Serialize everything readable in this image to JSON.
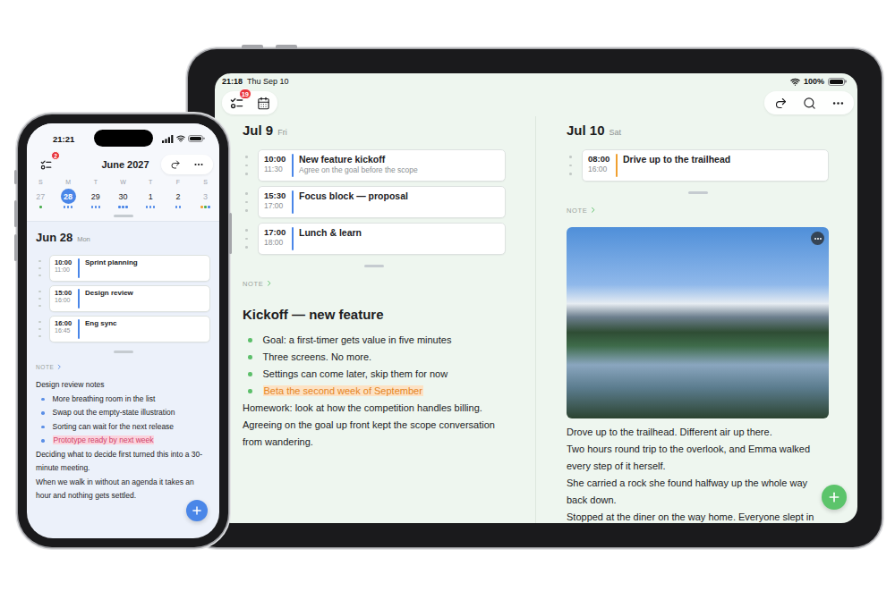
{
  "phone": {
    "status": {
      "time": "21:21",
      "battery_level": 1
    },
    "toolbar": {
      "badge": "2",
      "title": "June 2027"
    },
    "week": [
      {
        "weekday": "S",
        "date": "27",
        "selected": false,
        "muted": true,
        "dots": [
          "#4caf50"
        ]
      },
      {
        "weekday": "M",
        "date": "28",
        "selected": true,
        "muted": false,
        "dots": [
          "#4a86e8",
          "#4a86e8",
          "#4a86e8"
        ]
      },
      {
        "weekday": "T",
        "date": "29",
        "selected": false,
        "muted": false,
        "dots": [
          "#4a86e8",
          "#4a86e8",
          "#4a86e8"
        ]
      },
      {
        "weekday": "W",
        "date": "30",
        "selected": false,
        "muted": false,
        "dots": [
          "#4a86e8",
          "#4a86e8",
          "#4a86e8"
        ]
      },
      {
        "weekday": "T",
        "date": "1",
        "selected": false,
        "muted": false,
        "dots": [
          "#4a86e8",
          "#4a86e8",
          "#4a86e8"
        ]
      },
      {
        "weekday": "F",
        "date": "2",
        "selected": false,
        "muted": false,
        "dots": [
          "#4a86e8",
          "#4a86e8"
        ]
      },
      {
        "weekday": "S",
        "date": "3",
        "selected": false,
        "muted": true,
        "dots": [
          "#f0a030",
          "#4caf50",
          "#4a86e8"
        ]
      }
    ],
    "day": {
      "date": "Jun 28",
      "weekday": "Mon"
    },
    "events": [
      {
        "start": "10:00",
        "end": "11:00",
        "title": "Sprint planning",
        "subtitle": "",
        "color": "#4a86e8"
      },
      {
        "start": "15:00",
        "end": "16:00",
        "title": "Design review",
        "subtitle": "",
        "color": "#4a86e8"
      },
      {
        "start": "16:00",
        "end": "16:45",
        "title": "Eng sync",
        "subtitle": "",
        "color": "#4a86e8"
      }
    ],
    "note": {
      "label": "NOTE",
      "blocks": [
        {
          "kind": "line",
          "text": "Design review notes",
          "highlighted": false
        },
        {
          "kind": "bullet",
          "text": "More breathing room in the list",
          "highlighted": false
        },
        {
          "kind": "bullet",
          "text": "Swap out the empty-state illustration",
          "highlighted": false
        },
        {
          "kind": "bullet",
          "text": "Sorting can wait for the next release",
          "highlighted": false
        },
        {
          "kind": "bullet",
          "text": "Prototype ready by next week",
          "highlighted": true
        },
        {
          "kind": "line",
          "text": "Deciding what to decide first turned this into a 30-minute meeting.",
          "highlighted": false
        },
        {
          "kind": "line",
          "text": "When we walk in without an agenda it takes an hour and nothing gets settled.",
          "highlighted": false
        }
      ]
    }
  },
  "tablet": {
    "status": {
      "time": "21:18",
      "date": "Thu Sep 10",
      "battery": "100%",
      "battery_level": 1
    },
    "toolbar": {
      "badge": "19"
    },
    "columns": [
      {
        "day": {
          "date": "Jul 9",
          "weekday": "Fri"
        },
        "events": [
          {
            "start": "10:00",
            "end": "11:30",
            "title": "New feature kickoff",
            "subtitle": "Agree on the goal before the scope",
            "color": "#4a86e8"
          },
          {
            "start": "15:30",
            "end": "17:00",
            "title": "Focus block — proposal",
            "subtitle": "",
            "color": "#4a86e8"
          },
          {
            "start": "17:00",
            "end": "18:00",
            "title": "Lunch & learn",
            "subtitle": "",
            "color": "#4a86e8"
          }
        ],
        "note": {
          "label": "NOTE",
          "blocks": [
            {
              "kind": "heading",
              "text": "Kickoff — new feature",
              "highlighted": false
            },
            {
              "kind": "bullet",
              "text": "Goal: a first-timer gets value in five minutes",
              "highlighted": false
            },
            {
              "kind": "bullet",
              "text": "Three screens. No more.",
              "highlighted": false
            },
            {
              "kind": "bullet",
              "text": "Settings can come later, skip them for now",
              "highlighted": false
            },
            {
              "kind": "bullet",
              "text": "Beta the second week of September",
              "highlighted": true
            },
            {
              "kind": "line",
              "text": "Homework: look at how the competition handles billing.",
              "highlighted": false
            },
            {
              "kind": "line",
              "text": "Agreeing on the goal up front kept the scope conversation from wandering.",
              "highlighted": false
            }
          ]
        }
      },
      {
        "day": {
          "date": "Jul 10",
          "weekday": "Sat"
        },
        "events": [
          {
            "start": "08:00",
            "end": "16:00",
            "title": "Drive up to the trailhead",
            "subtitle": "",
            "color": "#f0a030"
          }
        ],
        "note": {
          "label": "NOTE",
          "blocks": [
            {
              "kind": "photo",
              "text": "",
              "highlighted": false
            },
            {
              "kind": "line",
              "text": "Drove up to the trailhead. Different air up there.",
              "highlighted": false
            },
            {
              "kind": "line",
              "text": "Two hours round trip to the overlook, and Emma walked every step of it herself.",
              "highlighted": false
            },
            {
              "kind": "line",
              "text": "She carried a rock she found halfway up the whole way back down.",
              "highlighted": false
            },
            {
              "kind": "line",
              "text": "Stopped at the diner on the way home. Everyone slept in",
              "highlighted": false
            }
          ]
        }
      }
    ]
  }
}
